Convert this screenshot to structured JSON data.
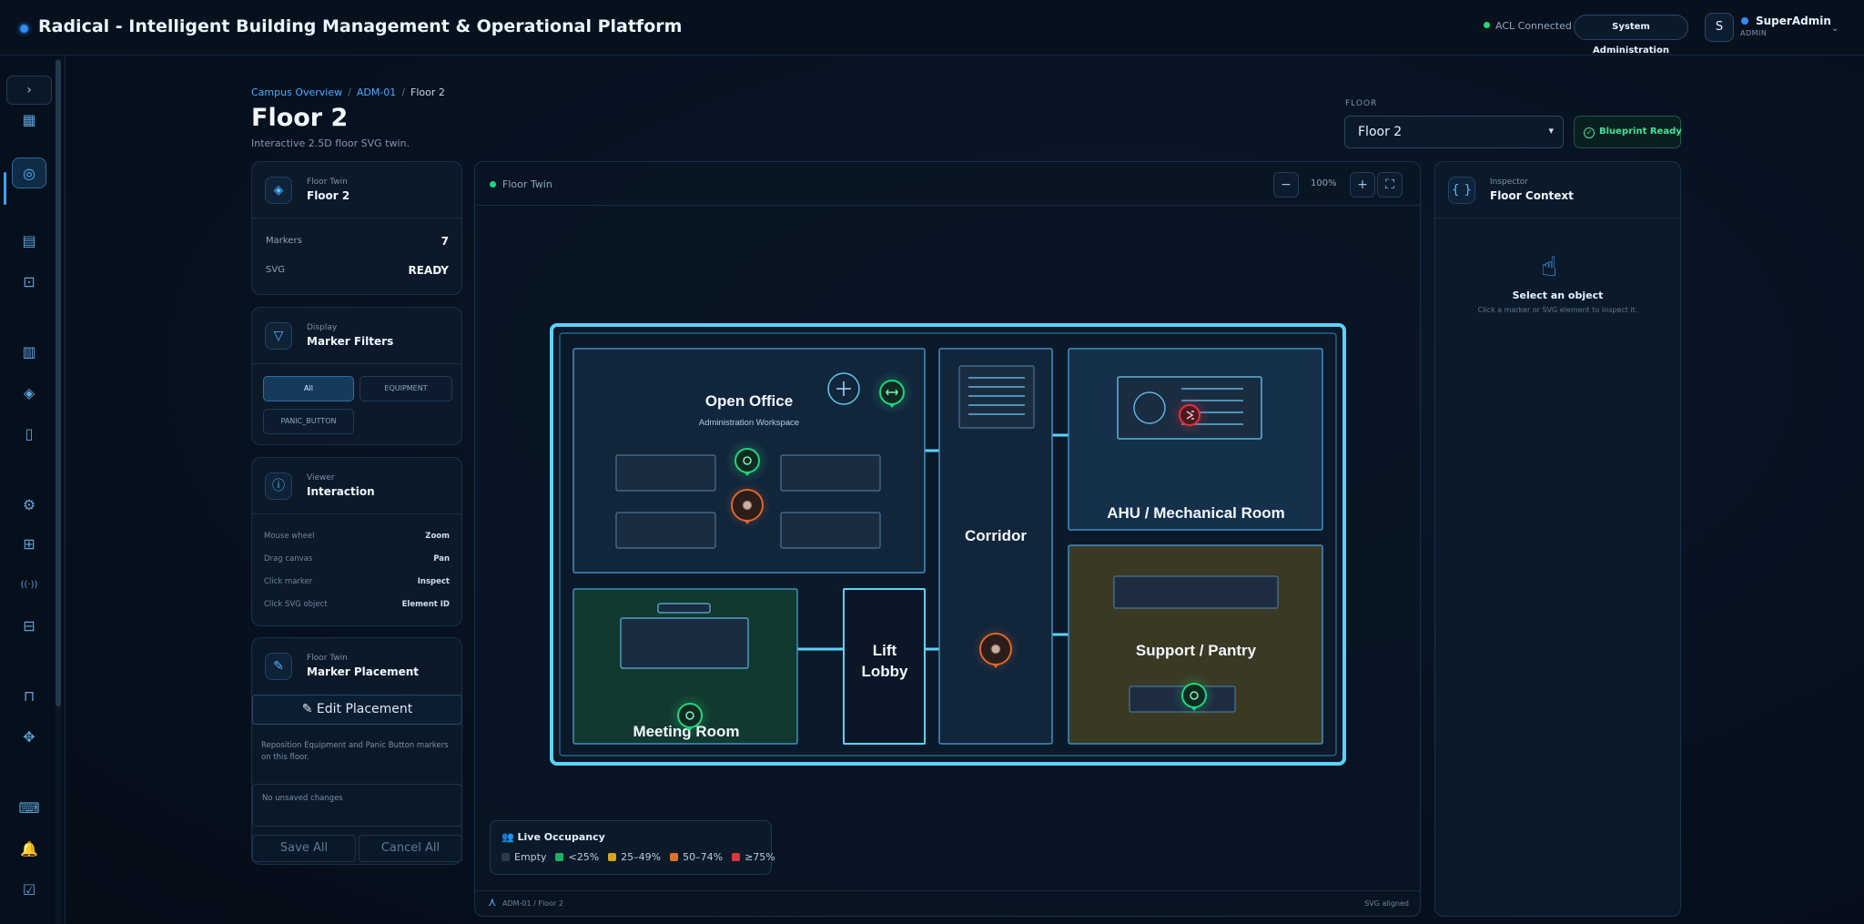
{
  "app": {
    "title": "Radical - Intelligent Building Management & Operational Platform",
    "acl_status": "ACL Connected",
    "system_admin_label": "System Administration",
    "user_initial": "S",
    "user_name": "SuperAdmin",
    "user_role": "ADMIN"
  },
  "sidebar": {
    "expand_glyph": "›",
    "items": [
      {
        "icon": "dashboard-icon",
        "glyph": "▦"
      },
      {
        "icon": "floor-twin-icon",
        "glyph": "◎",
        "active": true
      },
      {
        "icon": "analytics-icon",
        "glyph": "▤"
      },
      {
        "icon": "people-scan-icon",
        "glyph": "⊡"
      },
      {
        "icon": "buildings-icon",
        "glyph": "▥"
      },
      {
        "icon": "layers-icon",
        "glyph": "◈"
      },
      {
        "icon": "building-icon",
        "glyph": "▯"
      },
      {
        "icon": "robot-arm-icon",
        "glyph": "⚙"
      },
      {
        "icon": "chip-icon",
        "glyph": "⊞"
      },
      {
        "icon": "signal-icon",
        "glyph": "((·))"
      },
      {
        "icon": "network-icon",
        "glyph": "⊟"
      },
      {
        "icon": "elevator-icon",
        "glyph": "⊓"
      },
      {
        "icon": "move-icon",
        "glyph": "✥"
      },
      {
        "icon": "terminal-icon",
        "glyph": "⌨"
      },
      {
        "icon": "bell-icon",
        "glyph": "🔔"
      },
      {
        "icon": "checklist-icon",
        "glyph": "☑"
      }
    ]
  },
  "breadcrumb": {
    "campus": "Campus Overview",
    "building": "ADM-01",
    "floor": "Floor 2"
  },
  "page": {
    "title": "Floor 2",
    "subtitle": "Interactive 2.5D floor SVG twin."
  },
  "floor_selector": {
    "label": "FLOOR",
    "value": "Floor 2",
    "status": "Blueprint Ready"
  },
  "floor_twin_card": {
    "kicker": "Floor Twin",
    "title": "Floor 2",
    "markers_label": "Markers",
    "markers_value": "7",
    "svg_label": "SVG",
    "svg_value": "READY"
  },
  "filters_card": {
    "kicker": "Display",
    "title": "Marker Filters",
    "buttons": [
      "All",
      "EQUIPMENT",
      "PANIC_BUTTON"
    ]
  },
  "interaction_card": {
    "kicker": "Viewer",
    "title": "Interaction",
    "rows": [
      {
        "label": "Mouse wheel",
        "value": "Zoom"
      },
      {
        "label": "Drag canvas",
        "value": "Pan"
      },
      {
        "label": "Click marker",
        "value": "Inspect"
      },
      {
        "label": "Click SVG object",
        "value": "Element ID"
      }
    ]
  },
  "placement_card": {
    "kicker": "Floor Twin",
    "title": "Marker Placement",
    "edit_label": "Edit Placement",
    "description": "Reposition Equipment and Panic Button markers on this floor.",
    "unsaved": "No unsaved changes",
    "save_label": "Save All",
    "cancel_label": "Cancel All"
  },
  "viewer": {
    "label": "Floor Twin",
    "zoom": "100%",
    "rooms": {
      "open_office": "Open Office",
      "open_office_sub": "Administration Workspace",
      "corridor": "Corridor",
      "ahu": "AHU / Mechanical Room",
      "support": "Support / Pantry",
      "meeting": "Meeting Room",
      "lift_1": "Lift",
      "lift_2": "Lobby"
    },
    "legend": {
      "title": "Live Occupancy",
      "items": [
        {
          "label": "Empty",
          "color": "#2c3a4a"
        },
        {
          "label": "<25%",
          "color": "#1fae62"
        },
        {
          "label": "25–49%",
          "color": "#d8a21c"
        },
        {
          "label": "50–74%",
          "color": "#e0702a"
        },
        {
          "label": "≥75%",
          "color": "#d8363c"
        }
      ]
    },
    "footer_left": "ADM-01 / Floor 2",
    "footer_right": "SVG aligned"
  },
  "inspector": {
    "kicker": "Inspector",
    "title": "Floor Context",
    "empty_title": "Select an object",
    "empty_sub": "Click a marker or SVG element to inspect it."
  },
  "colors": {
    "accent": "#3aa6ff",
    "status_ok": "#22d67a",
    "marker_green": "#1fd67c",
    "marker_orange": "#e0662a",
    "marker_red": "#e5303a"
  }
}
